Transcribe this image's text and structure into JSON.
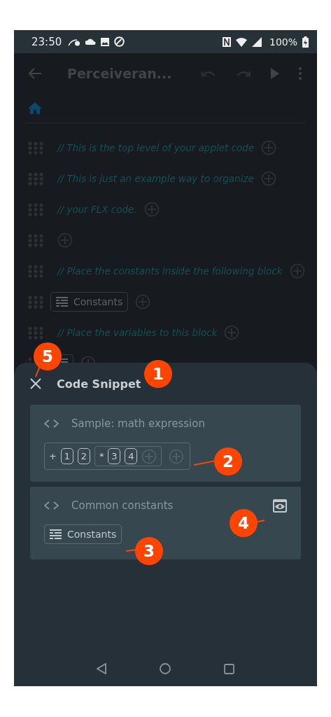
{
  "status_bar": {
    "time": "23:50",
    "battery": "100%"
  },
  "app_bar": {
    "title": "Perceiveran..."
  },
  "code_lines": [
    {
      "kind": "comment",
      "text": "// This is the top level of your applet code"
    },
    {
      "kind": "comment",
      "text": "// This is just an example way to organize"
    },
    {
      "kind": "comment",
      "text": "// your FLX code."
    },
    {
      "kind": "empty"
    },
    {
      "kind": "comment",
      "text": "// Place the constants inside the following block"
    },
    {
      "kind": "block",
      "text": "Constants"
    },
    {
      "kind": "comment",
      "text": "// Place the variables to this block"
    },
    {
      "kind": "block"
    }
  ],
  "sheet": {
    "title": "Code Snippet",
    "snippets": [
      {
        "kind": "expression",
        "title": "Sample: math expression",
        "expression": {
          "operator": "+",
          "items": [
            {
              "kind": "number",
              "text": "1"
            },
            {
              "kind": "number",
              "text": "2"
            },
            {
              "kind": "group",
              "operator": "*",
              "items": [
                {
                  "kind": "number",
                  "text": "3"
                },
                {
                  "kind": "number",
                  "text": "4"
                }
              ]
            }
          ]
        }
      },
      {
        "kind": "block",
        "title": "Common constants",
        "block": "Constants",
        "preview": true
      }
    ]
  },
  "callouts": [
    {
      "label": "1"
    },
    {
      "label": "2"
    },
    {
      "label": "3"
    },
    {
      "label": "4"
    },
    {
      "label": "5"
    }
  ]
}
